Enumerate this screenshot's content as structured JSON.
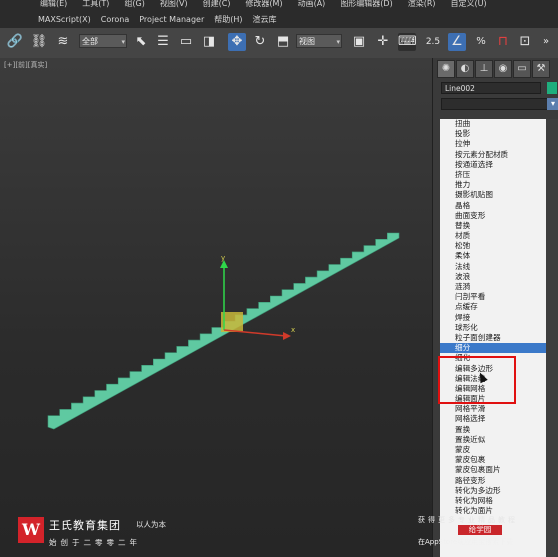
{
  "menubar": {
    "row1": [
      "编辑(E)",
      "工具(T)",
      "组(G)",
      "视图(V)",
      "创建(C)",
      "修改器(M)",
      "动画(A)",
      "图形编辑器(D)",
      "渲染(R)",
      "自定义(U)"
    ],
    "row2": [
      "MAXScript(X)",
      "Corona",
      "Project Manager",
      "帮助(H)",
      "渲云库"
    ]
  },
  "toolbar": {
    "selection_filter": "全部",
    "reference_coord": "视图",
    "snap_2_5": "2.5",
    "percent_snap": "%",
    "chevron": "»"
  },
  "viewport": {
    "label": "[+][前][真实]",
    "gizmo_y": "y",
    "gizmo_x": "x",
    "stair_color": "#5fc9a1"
  },
  "command_panel": {
    "tabs": [
      "sun-icon",
      "shape-icon",
      "hierarchy-icon",
      "motion-icon",
      "display-icon",
      "utilities-icon"
    ],
    "object_name": "Line002",
    "object_color": "#1fae7d",
    "modifier_list_value": ""
  },
  "modifier_list": {
    "items": [
      "扭曲",
      "投影",
      "拉伸",
      "按元素分配材质",
      "按通道选择",
      "挤压",
      "推力",
      "摄影机贴图",
      "晶格",
      "曲面变形",
      "替换",
      "材质",
      "松弛",
      "柔体",
      "法线",
      "波浪",
      "涟漪",
      "闩剖平看",
      "点缓存",
      "焊接",
      "球形化",
      "粒子面创建器",
      "细分",
      "细化",
      "编辑多边形",
      "编辑法线",
      "编辑网格",
      "编辑面片",
      "网格平滑",
      "网格选择",
      "置换",
      "置换近似",
      "蒙皮",
      "蒙皮包裹",
      "蒙皮包裹面片",
      "路径变形",
      "转化为多边形",
      "转化为网格",
      "转化为面片"
    ],
    "highlighted_index": 22
  },
  "branding": {
    "logo_letter": "W",
    "company": "王氏教育集团",
    "motto": "以人为本",
    "since": "始创于二零零二年"
  },
  "watermark": {
    "line1": "获得更多专业精品教程",
    "app": "给学园",
    "line2": "在AppStore或应用宝搜索下载"
  }
}
